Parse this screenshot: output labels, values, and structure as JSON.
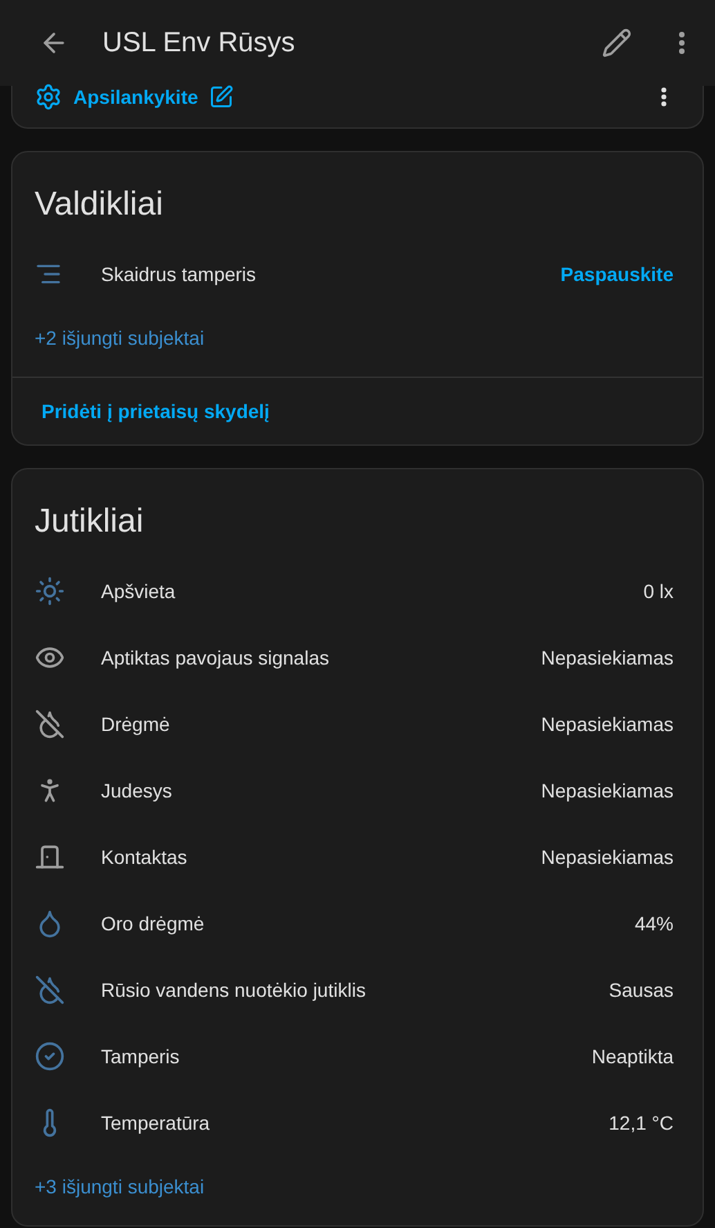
{
  "header": {
    "title": "USL Env Rūsys"
  },
  "top_card": {
    "link": "Apsilankykite"
  },
  "controls": {
    "title": "Valdikliai",
    "rows": [
      {
        "name": "Skaidrus tamperis",
        "action": "Paspauskite"
      }
    ],
    "disabled_link": "+2 išjungti subjektai",
    "footer_button": "Pridėti į prietaisų skydelį"
  },
  "sensors": {
    "title": "Jutikliai",
    "rows": [
      {
        "name": "Apšvieta",
        "value": "0 lx",
        "active": true
      },
      {
        "name": "Aptiktas pavojaus signalas",
        "value": "Nepasiekiamas",
        "active": false
      },
      {
        "name": "Drėgmė",
        "value": "Nepasiekiamas",
        "active": false
      },
      {
        "name": "Judesys",
        "value": "Nepasiekiamas",
        "active": false
      },
      {
        "name": "Kontaktas",
        "value": "Nepasiekiamas",
        "active": false
      },
      {
        "name": "Oro drėgmė",
        "value": "44%",
        "active": true
      },
      {
        "name": "Rūsio vandens nuotėkio jutiklis",
        "value": "Sausas",
        "active": true
      },
      {
        "name": "Tamperis",
        "value": "Neaptikta",
        "active": true
      },
      {
        "name": "Temperatūra",
        "value": "12,1 °C",
        "active": true
      }
    ],
    "disabled_link": "+3 išjungti subjektai"
  }
}
